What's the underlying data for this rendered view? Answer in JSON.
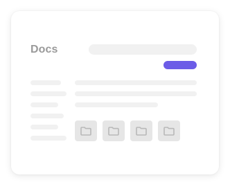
{
  "page": {
    "title": "Docs"
  },
  "colors": {
    "accent": "#6c5ce7",
    "placeholder": "#f1f1f1",
    "tile": "#e6e6e6",
    "icon": "#b8b8b8",
    "title_text": "#9a9a9a"
  },
  "sidebar": {
    "items": [
      "",
      "",
      "",
      "",
      "",
      ""
    ]
  },
  "content": {
    "lines": [
      "",
      "",
      ""
    ]
  },
  "folders": [
    {
      "icon": "folder-icon"
    },
    {
      "icon": "folder-icon"
    },
    {
      "icon": "folder-icon"
    },
    {
      "icon": "folder-icon"
    }
  ]
}
